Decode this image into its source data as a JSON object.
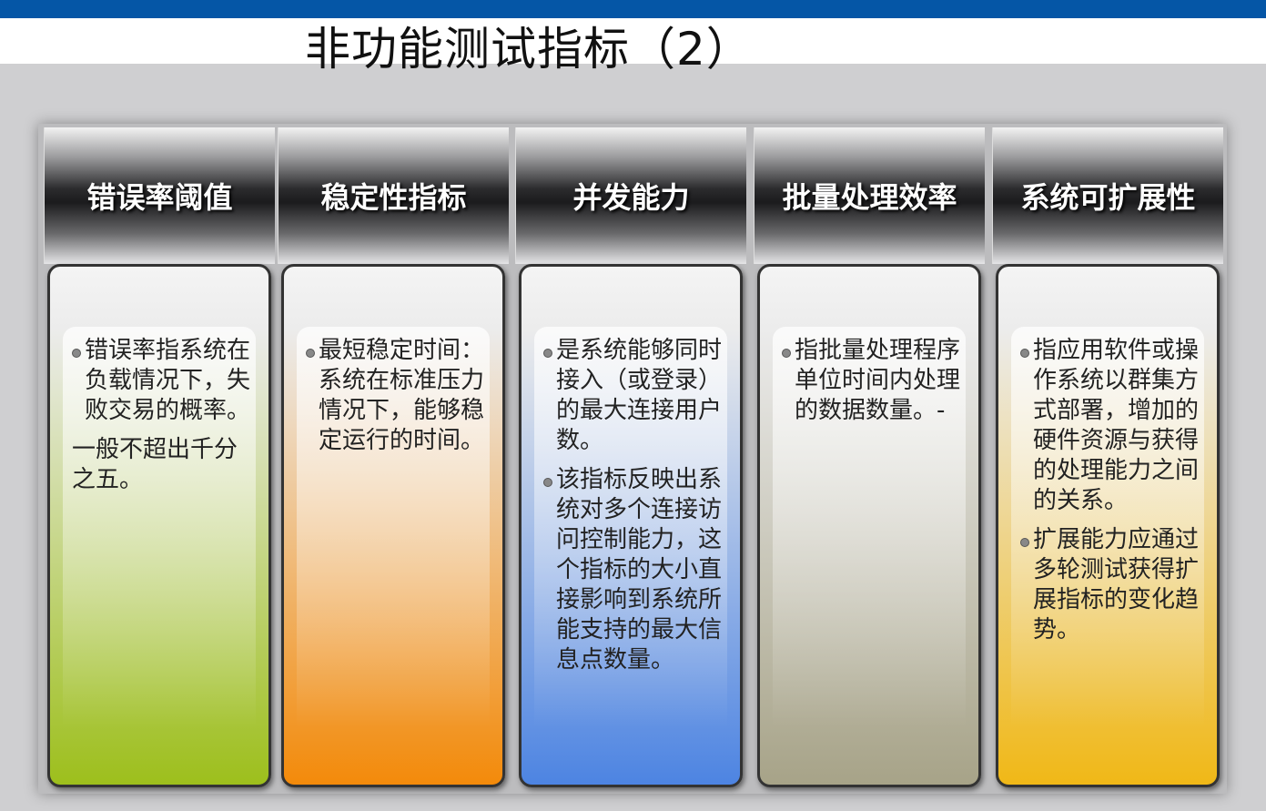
{
  "title": "非功能测试指标（2）",
  "columns": [
    {
      "heading": "错误率阈值",
      "paragraphs": [
        {
          "bullet": true,
          "text": "错误率指系统在负载情况下，失败交易的概率。"
        },
        {
          "bullet": false,
          "text": "一般不超出千分之五。"
        }
      ],
      "color": "#9dbf1c"
    },
    {
      "heading": "稳定性指标",
      "paragraphs": [
        {
          "bullet": true,
          "text": "最短稳定时间：系统在标准压力情况下，能够稳定运行的时间。"
        }
      ],
      "color": "#f38a0a"
    },
    {
      "heading": "并发能力",
      "paragraphs": [
        {
          "bullet": true,
          "text": "是系统能够同时接入（或登录）的最大连接用户数。"
        },
        {
          "bullet": true,
          "text": "该指标反映出系统对多个连接访问控制能力，这个指标的大小直接影响到系统所能支持的最大信息点数量。"
        }
      ],
      "color": "#4d84e2"
    },
    {
      "heading": "批量处理效率",
      "paragraphs": [
        {
          "bullet": true,
          "text": "指批量处理程序单位时间内处理的数据数量。-"
        }
      ],
      "color": "#a7a388"
    },
    {
      "heading": "系统可扩展性",
      "paragraphs": [
        {
          "bullet": true,
          "text": "指应用软件或操作系统以群集方式部署，增加的硬件资源与获得的处理能力之间的关系。"
        },
        {
          "bullet": true,
          "text": "扩展能力应通过多轮测试获得扩展指标的变化趋势。"
        }
      ],
      "color": "#f0b817"
    }
  ]
}
